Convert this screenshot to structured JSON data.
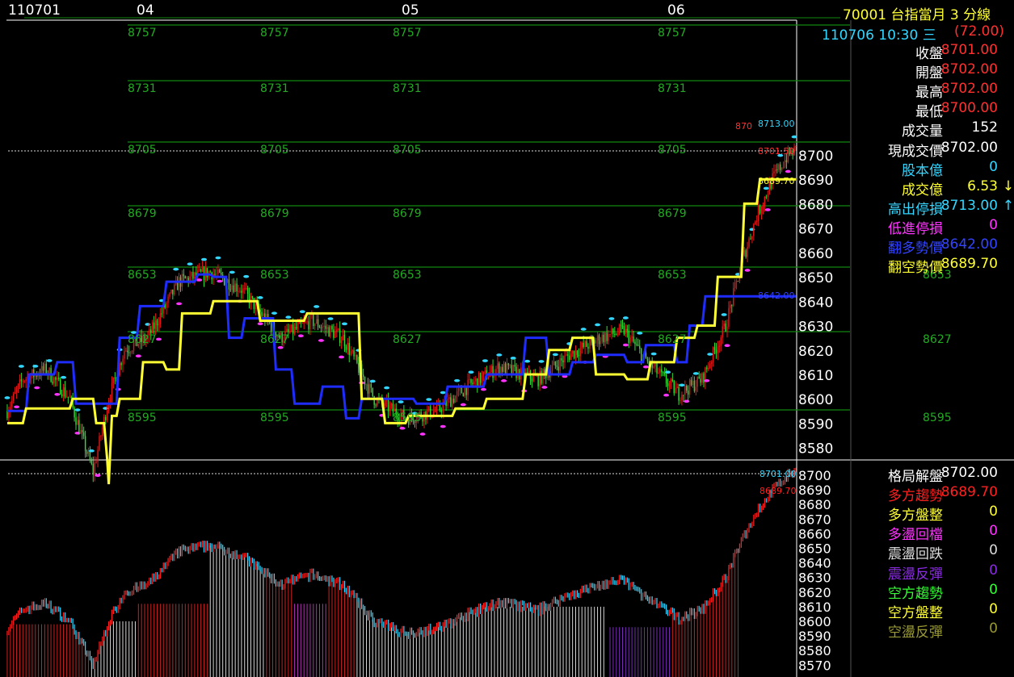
{
  "header": {
    "date_label": "110701",
    "day_labels": [
      "04",
      "05",
      "06"
    ],
    "symbol_line": "70001  台指當月 3 分線",
    "time_line": "110706 10:30 三",
    "change": "(72.00)"
  },
  "upper_panel": {
    "rows": [
      {
        "label": "收盤",
        "value": "8701.00",
        "label_color": "#ffffff",
        "value_color": "#ff3030"
      },
      {
        "label": "開盤",
        "value": "8702.00",
        "label_color": "#ffffff",
        "value_color": "#ff3030"
      },
      {
        "label": "最高",
        "value": "8702.00",
        "label_color": "#ffffff",
        "value_color": "#ff3030"
      },
      {
        "label": "最低",
        "value": "8700.00",
        "label_color": "#ffffff",
        "value_color": "#ff3030"
      },
      {
        "label": "成交量",
        "value": "152",
        "label_color": "#ffffff",
        "value_color": "#ffffff"
      },
      {
        "label": "現成交價",
        "value": "8702.00",
        "label_color": "#ffffff",
        "value_color": "#ffffff"
      },
      {
        "label": "股本億",
        "value": "0",
        "label_color": "#33d6ff",
        "value_color": "#33d6ff"
      },
      {
        "label": "成交億",
        "value": "6.53",
        "label_color": "#ffff33",
        "value_color": "#ffff33",
        "arrow": "↓",
        "arrow_color": "#ffff33"
      },
      {
        "label": "高出停損",
        "value": "8713.00",
        "label_color": "#33d6ff",
        "value_color": "#33d6ff",
        "arrow": "↑",
        "arrow_color": "#33d6ff"
      },
      {
        "label": "低進停損",
        "value": "0",
        "label_color": "#ff33ff",
        "value_color": "#ff33ff"
      },
      {
        "label": "翻多勢價",
        "value": "8642.00",
        "label_color": "#3344ff",
        "value_color": "#3344ff"
      },
      {
        "label": "翻空勢價",
        "value": "8689.70",
        "label_color": "#ffff33",
        "value_color": "#ffff33"
      }
    ]
  },
  "lower_panel": {
    "rows": [
      {
        "label": "格局解盤",
        "value": "8702.00",
        "label_color": "#ffffff",
        "value_color": "#ffffff"
      },
      {
        "label": "多方趨勢",
        "value": "8689.70",
        "label_color": "#ff2020",
        "value_color": "#ff2020"
      },
      {
        "label": "多方盤整",
        "value": "0",
        "label_color": "#ffff33",
        "value_color": "#ffff33"
      },
      {
        "label": "多盪回檔",
        "value": "0",
        "label_color": "#ff33ff",
        "value_color": "#ff33ff"
      },
      {
        "label": "震盪回跌",
        "value": "0",
        "label_color": "#dddddd",
        "value_color": "#dddddd"
      },
      {
        "label": "震盪反彈",
        "value": "0",
        "label_color": "#8a2be2",
        "value_color": "#8a2be2"
      },
      {
        "label": "空方趨勢",
        "value": "0",
        "label_color": "#33ff33",
        "value_color": "#33ff33"
      },
      {
        "label": "空方盤整",
        "value": "0",
        "label_color": "#ffff33",
        "value_color": "#ffff33"
      },
      {
        "label": "空盪反彈",
        "value": "0",
        "label_color": "#999933",
        "value_color": "#999933"
      }
    ]
  },
  "chart_data": [
    {
      "type": "line",
      "panel": "upper",
      "x_labels": [
        "04",
        "05",
        "06"
      ],
      "y_ticks": [
        8580,
        8590,
        8600,
        8610,
        8620,
        8630,
        8640,
        8650,
        8660,
        8670,
        8680,
        8690,
        8700
      ],
      "ylim": [
        8572,
        8762
      ],
      "level_lines": [
        "8757",
        "8731",
        "8705",
        "8679",
        "8653",
        "8627",
        "8595"
      ],
      "annotations": {
        "high_stop": "8713.00",
        "current": "8701.50",
        "bear_turn": "8689.70",
        "bull_turn": "8642.00",
        "high_mark": "870"
      },
      "colors": {
        "up": "#e01818",
        "down": "#33dd33",
        "bull_line": "#1e2cff",
        "bear_line": "#ffff33",
        "level": "#118811",
        "cyan_mark": "#33d6ff",
        "magenta_mark": "#ff33ff"
      },
      "anchors": [
        [
          0,
          8595
        ],
        [
          10,
          8608
        ],
        [
          25,
          8612
        ],
        [
          40,
          8600
        ],
        [
          55,
          8570
        ],
        [
          65,
          8600
        ],
        [
          75,
          8620
        ],
        [
          90,
          8625
        ],
        [
          110,
          8648
        ],
        [
          130,
          8652
        ],
        [
          150,
          8645
        ],
        [
          175,
          8625
        ],
        [
          195,
          8632
        ],
        [
          215,
          8625
        ],
        [
          235,
          8600
        ],
        [
          255,
          8592
        ],
        [
          275,
          8595
        ],
        [
          295,
          8605
        ],
        [
          315,
          8613
        ],
        [
          340,
          8608
        ],
        [
          360,
          8618
        ],
        [
          380,
          8625
        ],
        [
          395,
          8628
        ],
        [
          410,
          8615
        ],
        [
          430,
          8602
        ],
        [
          445,
          8608
        ],
        [
          460,
          8630
        ],
        [
          470,
          8655
        ],
        [
          480,
          8675
        ],
        [
          490,
          8690
        ],
        [
          500,
          8700
        ],
        [
          505,
          8702
        ]
      ],
      "bull_line_anchors": [
        [
          0,
          8595
        ],
        [
          12,
          8595
        ],
        [
          14,
          8610
        ],
        [
          30,
          8610
        ],
        [
          32,
          8615
        ],
        [
          42,
          8615
        ],
        [
          44,
          8598
        ],
        [
          70,
          8598
        ],
        [
          72,
          8625
        ],
        [
          83,
          8625
        ],
        [
          85,
          8638
        ],
        [
          100,
          8638
        ],
        [
          102,
          8648
        ],
        [
          120,
          8648
        ],
        [
          122,
          8651
        ],
        [
          130,
          8651
        ],
        [
          132,
          8650
        ],
        [
          140,
          8650
        ],
        [
          142,
          8625
        ],
        [
          150,
          8625
        ],
        [
          152,
          8633
        ],
        [
          170,
          8633
        ],
        [
          172,
          8612
        ],
        [
          182,
          8612
        ],
        [
          184,
          8598
        ],
        [
          200,
          8598
        ],
        [
          202,
          8605
        ],
        [
          215,
          8605
        ],
        [
          217,
          8592
        ],
        [
          225,
          8592
        ],
        [
          227,
          8600
        ],
        [
          260,
          8600
        ],
        [
          262,
          8598
        ],
        [
          280,
          8598
        ],
        [
          282,
          8605
        ],
        [
          305,
          8605
        ],
        [
          307,
          8610
        ],
        [
          330,
          8610
        ],
        [
          332,
          8625
        ],
        [
          345,
          8625
        ],
        [
          347,
          8610
        ],
        [
          360,
          8610
        ],
        [
          362,
          8615
        ],
        [
          375,
          8615
        ],
        [
          377,
          8618
        ],
        [
          395,
          8618
        ],
        [
          397,
          8615
        ],
        [
          407,
          8615
        ],
        [
          409,
          8622
        ],
        [
          427,
          8622
        ],
        [
          429,
          8615
        ],
        [
          435,
          8615
        ],
        [
          437,
          8630
        ],
        [
          445,
          8630
        ],
        [
          447,
          8642
        ],
        [
          505,
          8642
        ]
      ],
      "bear_line_anchors": [
        [
          0,
          8590
        ],
        [
          10,
          8590
        ],
        [
          12,
          8596
        ],
        [
          40,
          8596
        ],
        [
          42,
          8600
        ],
        [
          55,
          8600
        ],
        [
          57,
          8590
        ],
        [
          62,
          8590
        ],
        [
          64,
          8575
        ],
        [
          65,
          8565
        ],
        [
          67,
          8593
        ],
        [
          70,
          8593
        ],
        [
          72,
          8600
        ],
        [
          85,
          8600
        ],
        [
          87,
          8615
        ],
        [
          100,
          8615
        ],
        [
          102,
          8612
        ],
        [
          110,
          8612
        ],
        [
          112,
          8635
        ],
        [
          130,
          8635
        ],
        [
          132,
          8640
        ],
        [
          160,
          8640
        ],
        [
          162,
          8632
        ],
        [
          190,
          8632
        ],
        [
          192,
          8635
        ],
        [
          225,
          8635
        ],
        [
          227,
          8600
        ],
        [
          240,
          8600
        ],
        [
          242,
          8590
        ],
        [
          255,
          8590
        ],
        [
          257,
          8593
        ],
        [
          285,
          8593
        ],
        [
          287,
          8596
        ],
        [
          305,
          8596
        ],
        [
          307,
          8600
        ],
        [
          330,
          8600
        ],
        [
          332,
          8610
        ],
        [
          345,
          8610
        ],
        [
          347,
          8620
        ],
        [
          360,
          8620
        ],
        [
          362,
          8625
        ],
        [
          375,
          8625
        ],
        [
          377,
          8610
        ],
        [
          395,
          8610
        ],
        [
          397,
          8608
        ],
        [
          410,
          8608
        ],
        [
          412,
          8615
        ],
        [
          427,
          8615
        ],
        [
          429,
          8625
        ],
        [
          440,
          8625
        ],
        [
          442,
          8630
        ],
        [
          453,
          8630
        ],
        [
          455,
          8650
        ],
        [
          470,
          8650
        ],
        [
          472,
          8680
        ],
        [
          480,
          8680
        ],
        [
          482,
          8690
        ],
        [
          505,
          8690
        ]
      ]
    },
    {
      "type": "bar",
      "panel": "lower",
      "y_ticks": [
        8570,
        8580,
        8590,
        8600,
        8610,
        8620,
        8630,
        8640,
        8650,
        8660,
        8670,
        8680,
        8690,
        8700
      ],
      "ylim": [
        8567,
        8708
      ],
      "annotations": {
        "current": "8701.00",
        "trend": "8689.70"
      },
      "state_colors": {
        "bull_trend": "#cc2020",
        "shock_fall": "#d8d8d8",
        "bull_pullback": "#b233b2",
        "shock_bounce": "#7a2bb8"
      },
      "state_segments": [
        {
          "state": "bull_trend",
          "from": 0,
          "to": 52,
          "level": 8598
        },
        {
          "state": "shock_fall",
          "from": 53,
          "to": 82,
          "level": 8600
        },
        {
          "state": "bull_trend",
          "from": 84,
          "to": 128,
          "level": 8612
        },
        {
          "state": "shock_fall",
          "from": 130,
          "to": 164,
          "level": 8655
        },
        {
          "state": "bull_trend",
          "from": 165,
          "to": 182,
          "level": 8650
        },
        {
          "state": "bull_pullback",
          "from": 183,
          "to": 204,
          "level": 8612
        },
        {
          "state": "bull_trend",
          "from": 205,
          "to": 222,
          "level": 8640
        },
        {
          "state": "shock_fall",
          "from": 223,
          "to": 296,
          "level": 8622
        },
        {
          "state": "shock_fall",
          "from": 297,
          "to": 383,
          "level": 8610
        },
        {
          "state": "shock_bounce",
          "from": 385,
          "to": 425,
          "level": 8596
        },
        {
          "state": "bull_trend",
          "from": 426,
          "to": 450,
          "level": 8660
        },
        {
          "state": "bull_trend",
          "from": 451,
          "to": 469,
          "level": 8690
        }
      ]
    }
  ]
}
